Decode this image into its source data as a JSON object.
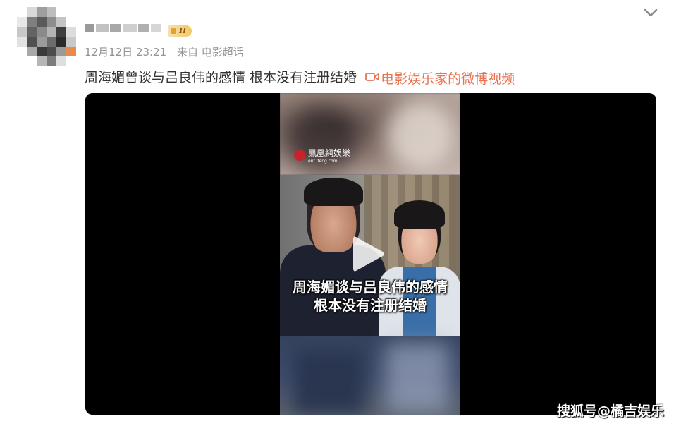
{
  "post": {
    "badge_label": "II",
    "timestamp": "12月12日 23:21",
    "source_prefix": "来自",
    "source_name": "电影超话",
    "text": "周海媚曾谈与吕良伟的感情 根本没有注册结婚 ",
    "video_link_label": "电影娱乐家的微博视频"
  },
  "video": {
    "watermark_name": "鳳凰網娛樂",
    "watermark_domain": "ent.ifeng.com",
    "caption_line1": "周海媚谈与吕良伟的感情",
    "caption_line2": "根本没有注册结婚"
  },
  "footer": {
    "watermark": "搜狐号@橘吉娱乐"
  },
  "colors": {
    "link": "#eb7350",
    "meta_text": "#939393",
    "body_text": "#333333",
    "player_bg": "#000000"
  },
  "icons": [
    "chevron-down-icon",
    "video-camera-icon",
    "play-icon",
    "ifeng-logo-icon"
  ]
}
